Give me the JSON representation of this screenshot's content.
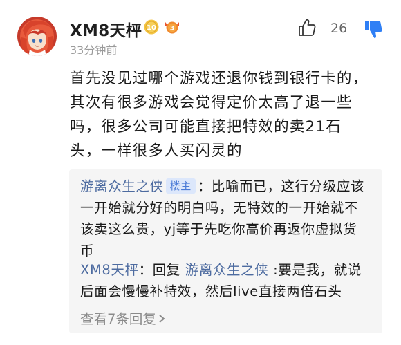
{
  "comment": {
    "username": "XM8天枰",
    "level_badge": "10",
    "medal_badge": "3",
    "timestamp": "33分钟前",
    "like_count": "26",
    "icons": {
      "like": "thumbs-up-outline-icon",
      "dislike": "thumbs-down-filled-icon",
      "accent": "#2f7ff5",
      "level_badge_color": "#f0b62b",
      "medal_badge_color": "#f07b2c"
    },
    "content": "首先没见过哪个游戏还退你钱到银行卡的，其次有很多游戏会觉得定价太高了退一些吗，很多公司可能直接把特效的卖21石头，一样很多人买闪灵的"
  },
  "replies": [
    {
      "user": "游离众生之侠",
      "op_badge": "楼主",
      "separator": "：",
      "text": "比喻而已，这行分级应该一开始就分好的明白吗，无特效的一开始就不该卖这么贵，yj等于先吃你高价再返你虚拟货币"
    },
    {
      "user": "XM8天枰",
      "separator": "：",
      "reply_word": "回复",
      "target": "游离众生之侠",
      "text": ":要是我，就说后面会慢慢补特效，然后live直接两倍石头"
    }
  ],
  "view_more": "查看7条回复"
}
